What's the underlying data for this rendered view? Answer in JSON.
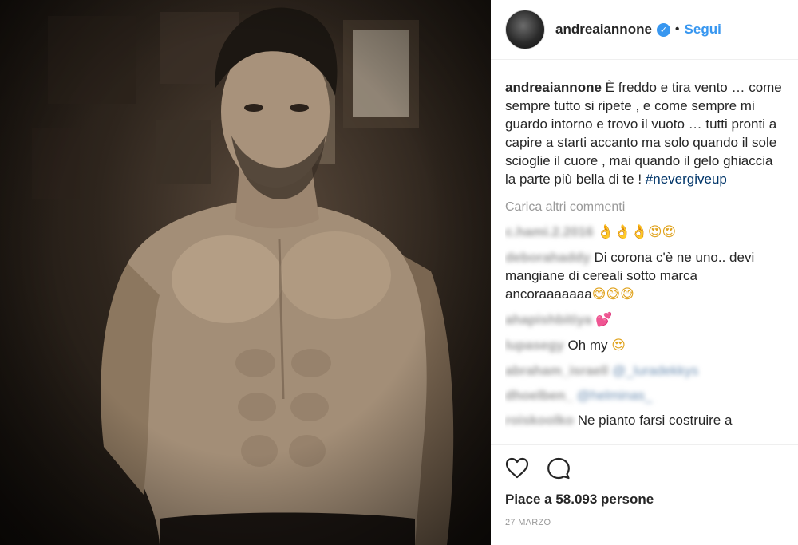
{
  "post": {
    "photo": {
      "description_icon": "photo"
    },
    "header": {
      "username": "andreaiannone",
      "verified_mark": "✓",
      "separator": "•",
      "follow_label": "Segui"
    },
    "caption": {
      "username": "andreaiannone",
      "text": "È freddo e tira vento … come sempre tutto si ripete , e come sempre mi guardo intorno e trovo il vuoto … tutti pronti a capire a starti accanto ma solo quando il sole scioglie il cuore , mai quando il gelo ghiaccia la parte più bella di te ! ",
      "hashtag": "#nevergiveup"
    },
    "load_more_label": "Carica altri commenti",
    "comments": [
      {
        "username": "c.hami.2.2016",
        "text": "",
        "emoji": "👌👌👌😍😍"
      },
      {
        "username": "deborahaddy",
        "text": "Di corona c'è ne uno.. devi mangiane di cereali sotto marca ancoraaaaaaa",
        "emoji": "😅😅😅"
      },
      {
        "username": "ahapishbitiya",
        "text": "",
        "emoji": "💕"
      },
      {
        "username": "lupasegy",
        "text": "Oh my ",
        "emoji": "😍"
      },
      {
        "username": "abraham_israell",
        "text": "",
        "mention": "@_luradekkys"
      },
      {
        "username": "dhoelben_",
        "text": "",
        "mention": "@helminas_"
      },
      {
        "username": "roiskoolko",
        "text": "Ne pianto farsi costruire a",
        "emoji": ""
      }
    ],
    "actions": {
      "like_icon": "heart-outline",
      "comment_icon": "speech-bubble"
    },
    "likes_text": "Piace a 58.093 persone",
    "date_text": "27 MARZO",
    "colors": {
      "link": "#3897f0",
      "hashtag": "#003569",
      "muted": "#999999",
      "text": "#262626"
    }
  }
}
